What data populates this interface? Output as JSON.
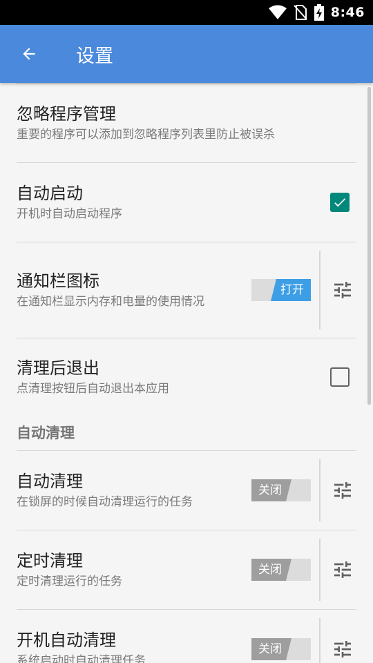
{
  "status_bar": {
    "time": "8:46"
  },
  "toolbar": {
    "title": "设置"
  },
  "items": [
    {
      "title": "忽略程序管理",
      "subtitle": "重要的程序可以添加到忽略程序列表里防止被误杀"
    },
    {
      "title": "自动启动",
      "subtitle": "开机时自动启动程序",
      "checked": true
    },
    {
      "title": "通知栏图标",
      "subtitle": "在通知栏显示内存和电量的使用情况",
      "switch_label": "打开"
    },
    {
      "title": "清理后退出",
      "subtitle": "点清理按钮后自动退出本应用",
      "checked": false
    }
  ],
  "section_auto_clean": {
    "header": "自动清理",
    "items": [
      {
        "title": "自动清理",
        "subtitle": "在锁屏的时候自动清理运行的任务",
        "switch_label": "关闭"
      },
      {
        "title": "定时清理",
        "subtitle": "定时清理运行的任务",
        "switch_label": "关闭"
      },
      {
        "title": "开机自动清理",
        "subtitle": "系统启动时自动清理任务",
        "switch_label": "关闭"
      }
    ]
  },
  "colors": {
    "toolbar": "#4a89dc",
    "checkbox_on": "#00897b",
    "switch_on": "#3d9ee5",
    "switch_off": "#9e9e9e"
  }
}
